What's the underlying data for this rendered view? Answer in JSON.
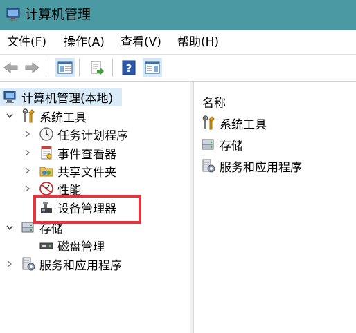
{
  "window": {
    "title": "计算机管理"
  },
  "menu": {
    "file": "文件(F)",
    "action": "操作(A)",
    "view": "查看(V)",
    "help": "帮助(H)"
  },
  "toolbar": {
    "back": "back-icon",
    "forward": "forward-icon",
    "show_hide_tree": "console-tree-icon",
    "export": "export-list-icon",
    "help": "help-icon",
    "action_pane": "action-pane-icon"
  },
  "tree": {
    "root": "计算机管理(本地)",
    "system_tools": "系统工具",
    "task_scheduler": "任务计划程序",
    "event_viewer": "事件查看器",
    "shared_folders": "共享文件夹",
    "performance": "性能",
    "device_manager": "设备管理器",
    "storage": "存储",
    "disk_management": "磁盘管理",
    "services_apps": "服务和应用程序"
  },
  "list": {
    "header": "名称",
    "items": [
      "系统工具",
      "存储",
      "服务和应用程序"
    ]
  },
  "colors": {
    "titlebar": "#4b9aa3",
    "highlight": "#e5343d",
    "selection": "#d9ebf9"
  }
}
